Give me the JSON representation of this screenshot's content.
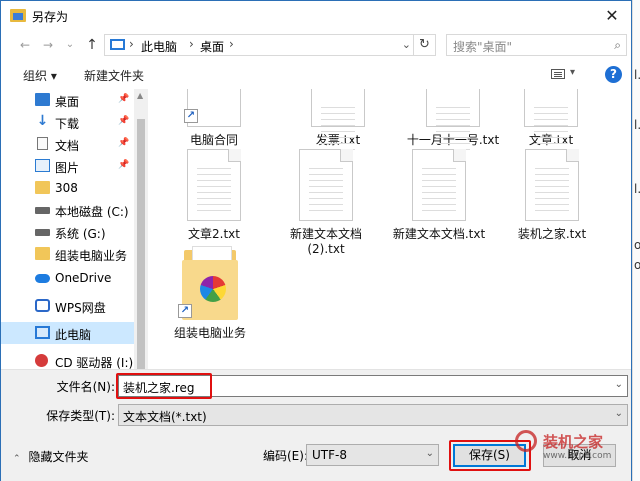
{
  "title": "另存为",
  "close_glyph": "✕",
  "nav": {
    "back": "←",
    "forward": "→",
    "dropdown": "⌄",
    "up": "↑",
    "breadcrumb": [
      "此电脑",
      "桌面"
    ],
    "separator": "›",
    "address_dropdown": "⌄",
    "refresh": "↻",
    "search_placeholder": "搜索\"桌面\"",
    "search_icon": "⌕"
  },
  "toolbar": {
    "organize": "组织 ▾",
    "new_folder": "新建文件夹",
    "view_dropdown": "▾",
    "help": "?"
  },
  "sidebar": {
    "items": [
      {
        "label": "桌面",
        "icon": "desktop-icon",
        "pinned": true
      },
      {
        "label": "下载",
        "icon": "download-icon",
        "pinned": true
      },
      {
        "label": "文档",
        "icon": "document-icon",
        "pinned": true
      },
      {
        "label": "图片",
        "icon": "picture-icon",
        "pinned": true
      },
      {
        "label": "308",
        "icon": "folder-icon",
        "pinned": false
      },
      {
        "label": "本地磁盘 (C:)",
        "icon": "drive-icon",
        "pinned": false
      },
      {
        "label": "系统 (G:)",
        "icon": "drive-icon",
        "pinned": false
      },
      {
        "label": "组装电脑业务",
        "icon": "folder-icon",
        "pinned": false
      },
      {
        "label": "OneDrive",
        "icon": "cloud-icon",
        "pinned": false
      },
      {
        "label": "WPS网盘",
        "icon": "wps-icon",
        "pinned": false
      },
      {
        "label": "此电脑",
        "icon": "pc-icon",
        "pinned": false,
        "selected": true
      },
      {
        "label": "CD 驱动器 (I:) BC",
        "icon": "cd-icon",
        "pinned": false
      }
    ],
    "pin_glyph": "📌",
    "download_arrow": "↓"
  },
  "files": [
    {
      "name": "电脑合同",
      "type": "shortcut"
    },
    {
      "name": "发票.txt",
      "type": "txt"
    },
    {
      "name": "十一月十一号.txt",
      "type": "txt"
    },
    {
      "name": "文章.txt",
      "type": "txt"
    },
    {
      "name": "文章2.txt",
      "type": "txt"
    },
    {
      "name": "新建文本文档\n(2).txt",
      "type": "txt"
    },
    {
      "name": "新建文本文档.txt",
      "type": "txt"
    },
    {
      "name": "装机之家.txt",
      "type": "txt"
    },
    {
      "name": "组装电脑业务",
      "type": "folder-shortcut"
    }
  ],
  "shortcut_glyph": "↗",
  "fields": {
    "filename_label": "文件名(N):",
    "filename_value": "装机之家.reg",
    "filetype_label": "保存类型(T):",
    "filetype_value": "文本文档(*.txt)",
    "dropdown": "⌄"
  },
  "footer": {
    "hide_folders": "隐藏文件夹",
    "hide_arrow": "⌃",
    "encoding_label": "编码(E):",
    "encoding_value": "UTF-8",
    "encoding_dropdown": "⌄",
    "save": "保存(S)",
    "cancel": "取消"
  },
  "watermark": {
    "brand": "装机之家",
    "url": "www.lotpc.com"
  },
  "background_text": [
    "l.",
    "l.",
    "l.",
    "ow",
    "ov"
  ],
  "colors": {
    "accent": "#0078d7",
    "selection": "#cce8ff",
    "highlight_box": "#e01010",
    "help": "#1e6fd4"
  }
}
